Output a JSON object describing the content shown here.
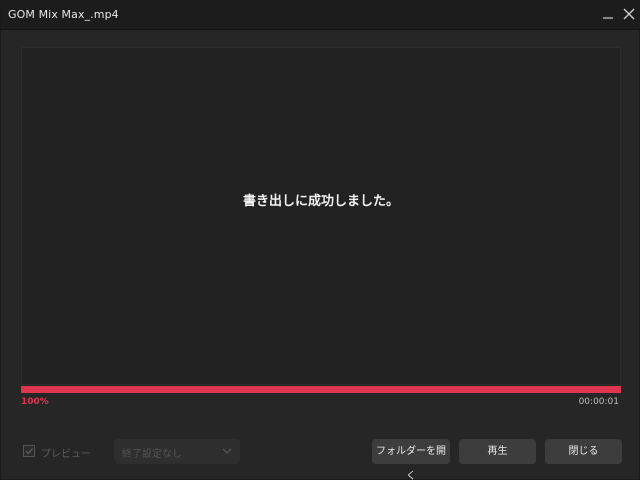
{
  "window": {
    "title": "GOM Mix Max_.mp4"
  },
  "preview": {
    "message": "書き出しに成功しました。"
  },
  "progress": {
    "percent_label": "100%",
    "value": 1.0,
    "time": "00:00:01",
    "color": "#e0354f"
  },
  "options": {
    "preview_checkbox_label": "プレビュー",
    "preview_checked": true,
    "end_setting_value": "終了設定なし"
  },
  "buttons": {
    "open_folder": "フォルダーを開く",
    "play": "再生",
    "close": "閉じる"
  },
  "icons": {
    "minimize": "minimize-icon",
    "close": "close-icon",
    "checkmark": "checkmark-icon",
    "chevron": "chevron-down-icon"
  }
}
